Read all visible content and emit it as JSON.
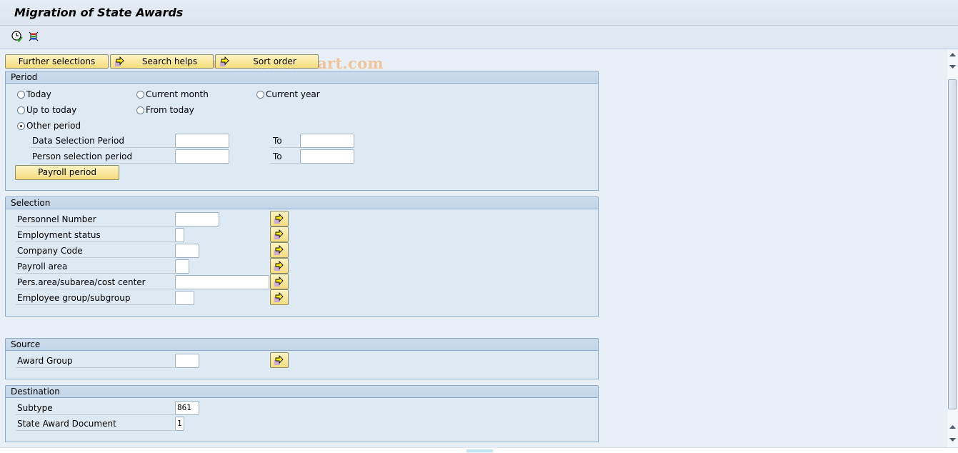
{
  "window": {
    "title": "Migration of State Awards",
    "watermark": "© www.tutorialkart.com"
  },
  "toolbar": {
    "icons": [
      "execute-clock-icon",
      "selection-screen-variant-icon"
    ]
  },
  "action_buttons": {
    "further_selections": "Further selections",
    "search_helps": "Search helps",
    "sort_order": "Sort order"
  },
  "period": {
    "title": "Period",
    "radios": [
      {
        "label": "Today",
        "selected": false
      },
      {
        "label": "Current month",
        "selected": false
      },
      {
        "label": "Current year",
        "selected": false
      },
      {
        "label": "Up to today",
        "selected": false
      },
      {
        "label": "From today",
        "selected": false
      },
      {
        "label": "Other period",
        "selected": true
      }
    ],
    "fields": [
      {
        "label": "Data Selection Period",
        "from": "",
        "to_label": "To",
        "to": ""
      },
      {
        "label": "Person selection period",
        "from": "",
        "to_label": "To",
        "to": ""
      }
    ],
    "payroll_button": "Payroll period"
  },
  "selection": {
    "title": "Selection",
    "fields": [
      {
        "label": "Personnel Number",
        "value": ""
      },
      {
        "label": "Employment status",
        "value": ""
      },
      {
        "label": "Company Code",
        "value": ""
      },
      {
        "label": "Payroll area",
        "value": ""
      },
      {
        "label": "Pers.area/subarea/cost center",
        "value": ""
      },
      {
        "label": "Employee group/subgroup",
        "value": ""
      }
    ]
  },
  "source": {
    "title": "Source",
    "fields": [
      {
        "label": "Award Group",
        "value": ""
      }
    ]
  },
  "destination": {
    "title": "Destination",
    "fields": [
      {
        "label": "Subtype",
        "value": "861"
      },
      {
        "label": "State Award Document",
        "value": "1"
      }
    ]
  },
  "colors": {
    "button_yellow": "#f5dc7c",
    "group_header": "#c2d5e8",
    "background": "#e8eff7",
    "watermark": "#efc49a"
  }
}
